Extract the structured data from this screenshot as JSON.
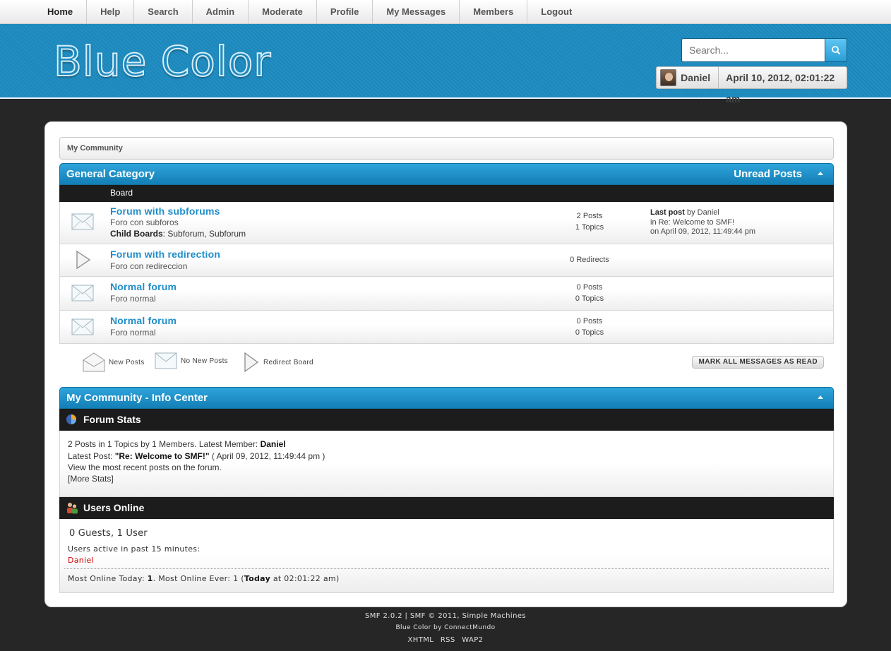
{
  "nav": {
    "items": [
      "Home",
      "Help",
      "Search",
      "Admin",
      "Moderate",
      "Profile",
      "My Messages",
      "Members",
      "Logout"
    ]
  },
  "header": {
    "logo_text": "Blue Color",
    "search_placeholder": "Search...",
    "user_name": "Daniel",
    "date": "April 10, 2012, 02:01:22 am"
  },
  "breadcrumb": "My Community",
  "category": {
    "title": "General Category",
    "right_label": "Unread Posts",
    "column_header": "Board",
    "boards": [
      {
        "icon": "envelope-icon",
        "title": "Forum with subforums",
        "description": "Foro con subforos",
        "child_label": "Child Boards",
        "child_links": [
          "Subforum",
          "Subforum"
        ],
        "posts": "2 Posts",
        "topics": "1 Topics",
        "last_post_label": "Last post",
        "last_post_by": "by Daniel",
        "last_post_in": "in Re: Welcome to SMF!",
        "last_post_on": "on April 09, 2012, 11:49:44 pm"
      },
      {
        "icon": "redirect-icon",
        "title": "Forum with redirection",
        "description": "Foro con redireccion",
        "redirects": "0 Redirects"
      },
      {
        "icon": "envelope-icon",
        "title": "Normal forum",
        "description": "Foro normal",
        "posts": "0 Posts",
        "topics": "0 Topics"
      },
      {
        "icon": "envelope-icon",
        "title": "Normal forum",
        "description": "Foro normal",
        "posts": "0 Posts",
        "topics": "0 Topics"
      }
    ]
  },
  "legend": {
    "new_posts": "New Posts",
    "no_new_posts": "No New Posts",
    "redirect_board": "Redirect Board",
    "mark_read": "MARK ALL MESSAGES AS READ"
  },
  "info_center": {
    "title": "My Community - Info Center",
    "forum_stats": {
      "heading": "Forum Stats",
      "line1_text": "2 Posts in 1 Topics by 1 Members. Latest Member: ",
      "latest_member": "Daniel",
      "line2_text": "Latest Post: ",
      "latest_post": "\"Re: Welcome to SMF!\"",
      "latest_post_date": " ( April 09, 2012, 11:49:44 pm )",
      "line3": "View the most recent posts on the forum.",
      "more_stats": "[More Stats]"
    },
    "users_online": {
      "heading": "Users Online",
      "summary": "0 Guests, 1 User",
      "active_label": "Users active in past 15 minutes:",
      "active_user": "Daniel",
      "most_online_prefix": "Most Online Today: ",
      "most_today": "1",
      "most_ever_prefix": ". Most Online Ever: 1 (",
      "most_ever_when": "Today",
      "most_ever_suffix": " at 02:01:22 am)"
    }
  },
  "footer": {
    "line1": "SMF 2.0.2 | SMF © 2011, Simple Machines",
    "line2": "Blue Color by ConnectMundo",
    "links": [
      "XHTML",
      "RSS",
      "WAP2"
    ]
  },
  "colors": {
    "accent": "#1f8ec9",
    "header_bg": "#1d8bc0",
    "page_bg": "#262626",
    "online_user": "#cc0000"
  }
}
